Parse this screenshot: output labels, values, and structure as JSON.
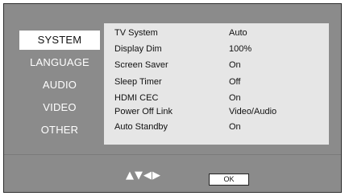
{
  "menu": {
    "items": [
      {
        "label": "SYSTEM"
      },
      {
        "label": "LANGUAGE"
      },
      {
        "label": "AUDIO"
      },
      {
        "label": "VIDEO"
      },
      {
        "label": "OTHER"
      }
    ],
    "selected": "SYSTEM"
  },
  "settings": {
    "rows": [
      {
        "label": "TV System",
        "value": "Auto"
      },
      {
        "label": "Display Dim",
        "value": "100%"
      },
      {
        "label": "Screen Saver",
        "value": "On"
      },
      {
        "label": "Sleep Timer",
        "value": "Off"
      },
      {
        "label": "HDMI CEC",
        "value": "On"
      },
      {
        "label": "Power Off Link",
        "value": "Video/Audio"
      },
      {
        "label": "Auto Standby",
        "value": "On"
      }
    ]
  },
  "footer": {
    "nav_arrows": "▲▼◀▶",
    "ok_label": "OK"
  },
  "colors": {
    "background": "#8b8b8b",
    "panel": "#e6e6e6",
    "selected_item": "#ffffff"
  }
}
